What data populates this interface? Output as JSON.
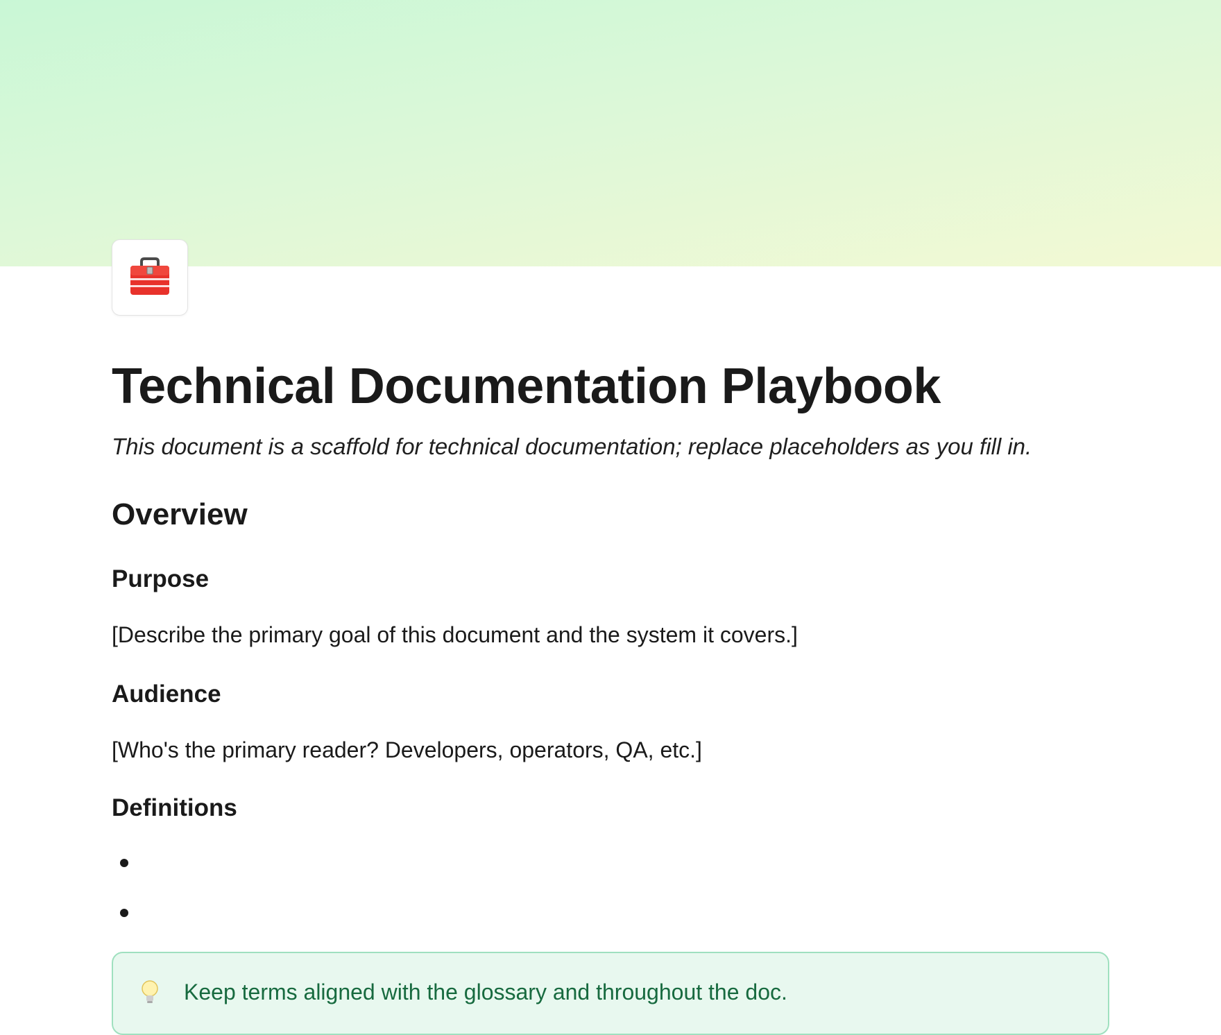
{
  "page": {
    "icon": "toolbox-icon",
    "title": "Technical Documentation Playbook",
    "subtitle": "This document is a scaffold for technical documentation; replace placeholders as you fill in."
  },
  "sections": {
    "overview": {
      "heading": "Overview",
      "purpose": {
        "heading": "Purpose",
        "text": "[Describe the primary goal of this document and the system it covers.]"
      },
      "audience": {
        "heading": "Audience",
        "text": "[Who's the primary reader? Developers, operators, QA, etc.]"
      },
      "definitions": {
        "heading": "Definitions",
        "items": [
          "",
          ""
        ]
      }
    }
  },
  "callout": {
    "icon": "lightbulb-icon",
    "text": "Keep terms aligned with the glossary and throughout the doc."
  },
  "colors": {
    "cover_start": "#c9f7d6",
    "cover_end": "#f3f9d4",
    "callout_bg": "#e8f8ef",
    "callout_border": "#9fe0bf",
    "callout_text": "#176a3f"
  }
}
